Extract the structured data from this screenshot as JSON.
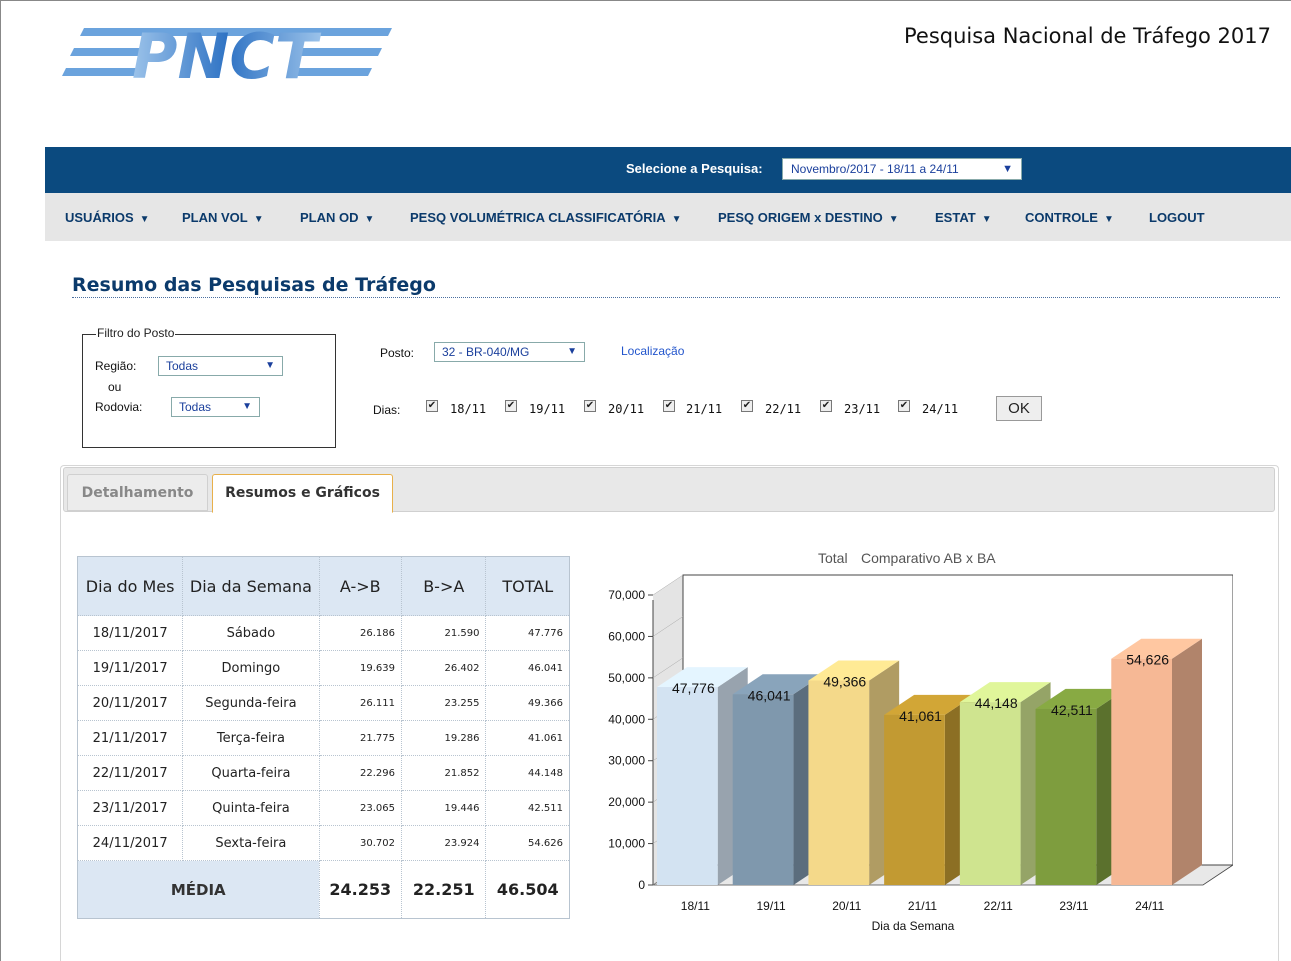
{
  "header": {
    "site_title": "Pesquisa Nacional de Tráfego 2017",
    "logo_text": "PNCT",
    "select_label": "Selecione a Pesquisa:",
    "select_value": "Novembro/2017 - 18/11 a 24/11"
  },
  "nav": [
    {
      "label": "USUÁRIOS",
      "has_caret": true
    },
    {
      "label": "PLAN VOL",
      "has_caret": true
    },
    {
      "label": "PLAN OD",
      "has_caret": true
    },
    {
      "label": "PESQ VOLUMÉTRICA CLASSIFICATÓRIA",
      "has_caret": true
    },
    {
      "label": "PESQ ORIGEM x DESTINO",
      "has_caret": true
    },
    {
      "label": "ESTAT",
      "has_caret": true
    },
    {
      "label": "CONTROLE",
      "has_caret": true
    },
    {
      "label": "LOGOUT",
      "has_caret": false
    }
  ],
  "page_title": "Resumo das Pesquisas de Tráfego",
  "filter": {
    "legend": "Filtro do Posto",
    "regiao_label": "Região:",
    "regiao_value": "Todas",
    "ou_label": "ou",
    "rodovia_label": "Rodovia:",
    "rodovia_value": "Todas",
    "posto_label": "Posto:",
    "posto_value": "32 - BR-040/MG",
    "localizacao_link": "Localização",
    "dias_label": "Dias:",
    "dias": [
      "18/11",
      "19/11",
      "20/11",
      "21/11",
      "22/11",
      "23/11",
      "24/11"
    ],
    "ok_label": "OK"
  },
  "tabs": {
    "detalhamento": "Detalhamento",
    "resumos": "Resumos e Gráficos"
  },
  "table": {
    "headers": [
      "Dia do Mes",
      "Dia da Semana",
      "A->B",
      "B->A",
      "TOTAL"
    ],
    "rows": [
      [
        "18/11/2017",
        "Sábado",
        "26.186",
        "21.590",
        "47.776"
      ],
      [
        "19/11/2017",
        "Domingo",
        "19.639",
        "26.402",
        "46.041"
      ],
      [
        "20/11/2017",
        "Segunda-feira",
        "26.111",
        "23.255",
        "49.366"
      ],
      [
        "21/11/2017",
        "Terça-feira",
        "21.775",
        "19.286",
        "41.061"
      ],
      [
        "22/11/2017",
        "Quarta-feira",
        "22.296",
        "21.852",
        "44.148"
      ],
      [
        "23/11/2017",
        "Quinta-feira",
        "23.065",
        "19.446",
        "42.511"
      ],
      [
        "24/11/2017",
        "Sexta-feira",
        "30.702",
        "23.924",
        "54.626"
      ]
    ],
    "media_label": "MÉDIA",
    "media_values": [
      "24.253",
      "22.251",
      "46.504"
    ]
  },
  "chart_data": {
    "type": "bar",
    "title": "Total",
    "subtitle": "Comparativo AB x BA",
    "xlabel": "Dia da Semana",
    "ylabel": "",
    "categories": [
      "18/11",
      "19/11",
      "20/11",
      "21/11",
      "22/11",
      "23/11",
      "24/11"
    ],
    "values": [
      47776,
      46041,
      49366,
      41061,
      44148,
      42511,
      54626
    ],
    "value_labels": [
      "47,776",
      "46,041",
      "49,366",
      "41,061",
      "44,148",
      "42,511",
      "54,626"
    ],
    "y_ticks": [
      "0",
      "10,000",
      "20,000",
      "30,000",
      "40,000",
      "50,000",
      "60,000",
      "70,000"
    ],
    "ylim": [
      0,
      70000
    ],
    "colors": [
      "#d3e3f2",
      "#7f98ad",
      "#f4d98a",
      "#c29a32",
      "#cfe48f",
      "#7e9d3e",
      "#f6b895"
    ],
    "style": "3d"
  }
}
